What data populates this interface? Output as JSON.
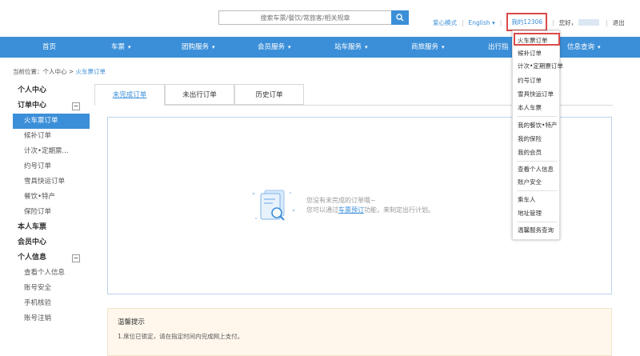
{
  "header": {
    "search_placeholder": "搜索车票/餐饮/常旅客/相关规章",
    "care_mode": "爱心模式",
    "language": "English",
    "language_caret": "▾",
    "my_12306": "我的12306",
    "greeting": "您好，",
    "logout": "退出"
  },
  "nav": {
    "items": [
      {
        "label": "首页"
      },
      {
        "label": "车票",
        "caret": "▾"
      },
      {
        "label": "团购服务",
        "caret": "▾"
      },
      {
        "label": "会员服务",
        "caret": "▾"
      },
      {
        "label": "站车服务",
        "caret": "▾"
      },
      {
        "label": "商旅服务",
        "caret": "▾"
      },
      {
        "label": "出行指",
        "caret": ""
      },
      {
        "label": "信息查询",
        "caret": "▾"
      }
    ]
  },
  "breadcrumb": {
    "prefix": "当前位置：个人中心 > ",
    "current": "火车票订单"
  },
  "sidebar": {
    "personal_center": "个人中心",
    "orders_head": "订单中心",
    "orders_toggle": "−",
    "orders": [
      "火车票订单",
      "候补订单",
      "计次•定期票...",
      "约号订单",
      "雪具快运订单",
      "餐饮•特产",
      "保险订单"
    ],
    "my_tickets": "本人车票",
    "member_center": "会员中心",
    "info_head": "个人信息",
    "info_toggle": "−",
    "info": [
      "查看个人信息",
      "账号安全",
      "手机核验",
      "账号注销"
    ]
  },
  "tabs": [
    {
      "label": "未完成订单"
    },
    {
      "label": "未出行订单"
    },
    {
      "label": "历史订单"
    }
  ],
  "empty": {
    "line1": "您没有未完成的订单哦~",
    "line2_pre": "您可以通过",
    "line2_link": "车票预订",
    "line2_post": "功能，来制定出行计划。"
  },
  "tips": {
    "title": "温馨提示",
    "line1": "1.席位已锁定，请在指定时间内完成网上支付。"
  },
  "dropdown": {
    "items": [
      "火车票订单",
      "候补订单",
      "计次•定期票订单",
      "约号订单",
      "雪具快运订单",
      "本人车票",
      "我的餐饮•特产",
      "我的保险",
      "我的会员",
      "查看个人信息",
      "账户安全",
      "乘车人",
      "地址管理",
      "温馨服务查询"
    ]
  },
  "colors": {
    "brand_blue": "#3b8fd8",
    "highlight_red": "#d94a4a"
  }
}
